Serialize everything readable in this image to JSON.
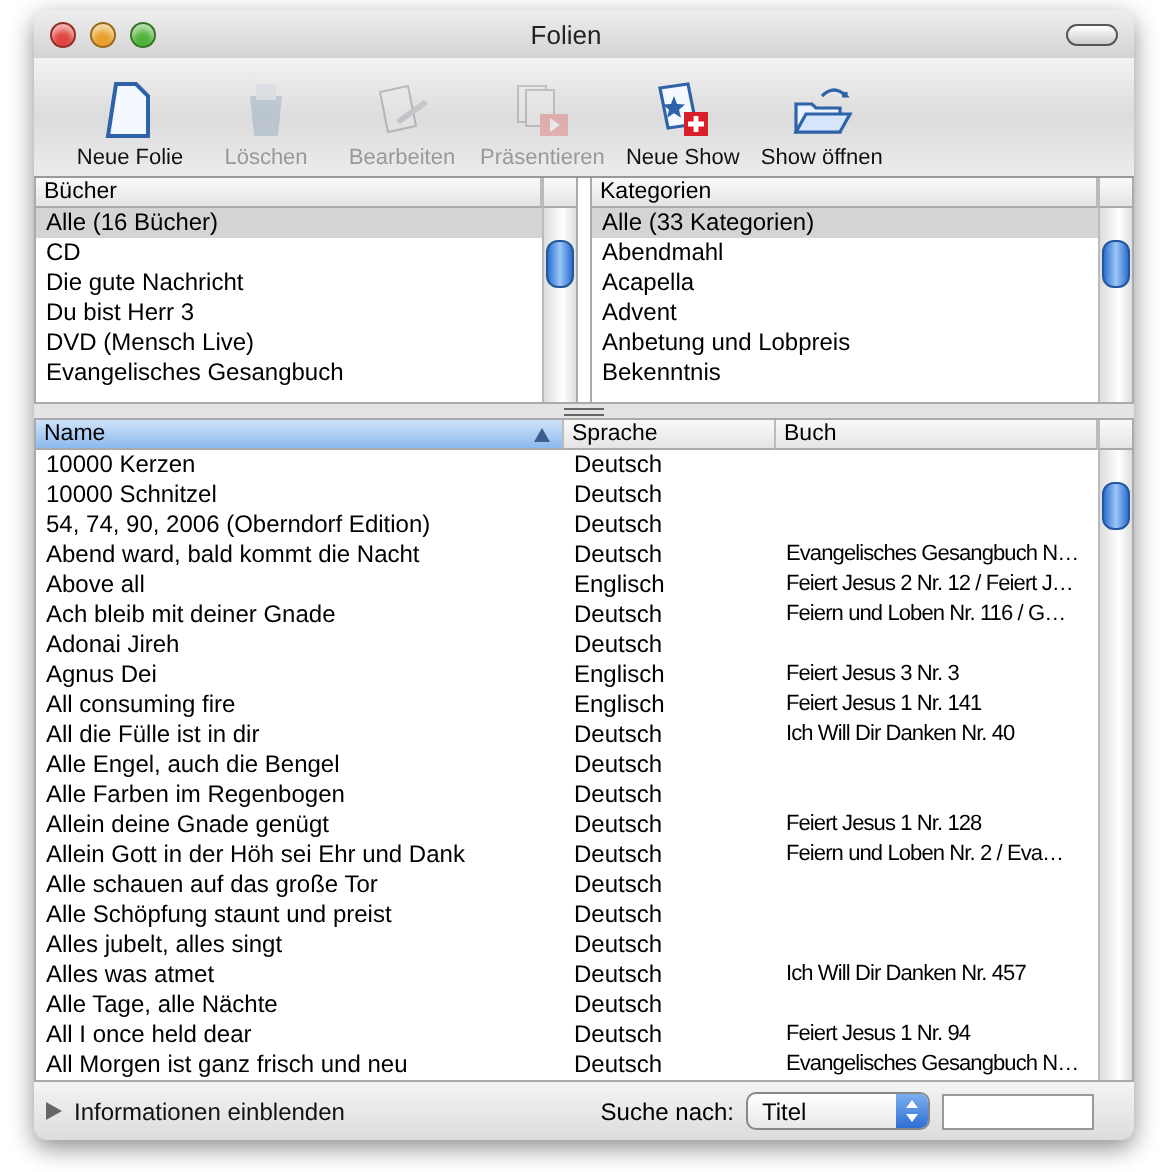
{
  "window": {
    "title": "Folien"
  },
  "toolbar": [
    {
      "label": "Neue Folie",
      "kind": "new-slide",
      "disabled": false
    },
    {
      "label": "Löschen",
      "kind": "delete",
      "disabled": true
    },
    {
      "label": "Bearbeiten",
      "kind": "edit",
      "disabled": true
    },
    {
      "label": "Präsentieren",
      "kind": "present",
      "disabled": true
    },
    {
      "label": "Neue Show",
      "kind": "new-show",
      "disabled": false
    },
    {
      "label": "Show öffnen",
      "kind": "open-show",
      "disabled": false
    }
  ],
  "books": {
    "header": "Bücher",
    "items": [
      {
        "label": "Alle (16 Bücher)",
        "selected": true
      },
      {
        "label": "CD",
        "selected": false
      },
      {
        "label": "Die gute Nachricht",
        "selected": false
      },
      {
        "label": "Du bist Herr 3",
        "selected": false
      },
      {
        "label": "DVD (Mensch Live)",
        "selected": false
      },
      {
        "label": "Evangelisches Gesangbuch",
        "selected": false
      }
    ]
  },
  "categories": {
    "header": "Kategorien",
    "items": [
      {
        "label": "Alle (33 Kategorien)",
        "selected": true
      },
      {
        "label": "Abendmahl",
        "selected": false
      },
      {
        "label": "Acapella",
        "selected": false
      },
      {
        "label": "Advent",
        "selected": false
      },
      {
        "label": "Anbetung und Lobpreis",
        "selected": false
      },
      {
        "label": "Bekenntnis",
        "selected": false
      }
    ]
  },
  "table": {
    "columns": [
      {
        "label": "Name",
        "selected": true
      },
      {
        "label": "Sprache",
        "selected": false
      },
      {
        "label": "Buch",
        "selected": false
      }
    ],
    "rows": [
      [
        "10000 Kerzen",
        "Deutsch",
        ""
      ],
      [
        "10000 Schnitzel",
        "Deutsch",
        ""
      ],
      [
        "54, 74, 90, 2006 (Oberndorf Edition)",
        "Deutsch",
        ""
      ],
      [
        "Abend ward, bald kommt die Nacht",
        "Deutsch",
        "Evangelisches Gesangbuch N…"
      ],
      [
        "Above all",
        "Englisch",
        "Feiert Jesus 2 Nr. 12 / Feiert J…"
      ],
      [
        "Ach bleib mit deiner Gnade",
        "Deutsch",
        "Feiern und Loben Nr. 116 / G…"
      ],
      [
        "Adonai Jireh",
        "Deutsch",
        ""
      ],
      [
        "Agnus Dei",
        "Englisch",
        "Feiert Jesus 3 Nr. 3"
      ],
      [
        "All consuming fire",
        "Englisch",
        "Feiert Jesus 1 Nr. 141"
      ],
      [
        "All die Fülle ist in dir",
        "Deutsch",
        "Ich Will Dir Danken Nr. 40"
      ],
      [
        "Alle Engel, auch die Bengel",
        "Deutsch",
        ""
      ],
      [
        "Alle Farben im Regenbogen",
        "Deutsch",
        ""
      ],
      [
        "Allein deine Gnade genügt",
        "Deutsch",
        "Feiert Jesus 1 Nr. 128"
      ],
      [
        "Allein Gott in der Höh sei Ehr und Dank",
        "Deutsch",
        "Feiern und Loben Nr. 2 / Eva…"
      ],
      [
        "Alle schauen auf das große Tor",
        "Deutsch",
        ""
      ],
      [
        "Alle Schöpfung staunt und preist",
        "Deutsch",
        ""
      ],
      [
        "Alles jubelt, alles singt",
        "Deutsch",
        ""
      ],
      [
        "Alles was atmet",
        "Deutsch",
        "Ich Will Dir Danken Nr. 457"
      ],
      [
        "Alle Tage, alle Nächte",
        "Deutsch",
        ""
      ],
      [
        "All I once held dear",
        "Deutsch",
        "Feiert Jesus 1 Nr. 94"
      ],
      [
        "All Morgen ist ganz frisch und neu",
        "Deutsch",
        "Evangelisches Gesangbuch N…"
      ]
    ]
  },
  "bottom_bar": {
    "disclosure": "Informationen einblenden",
    "search_label": "Suche nach:",
    "search_by": "Titel"
  }
}
